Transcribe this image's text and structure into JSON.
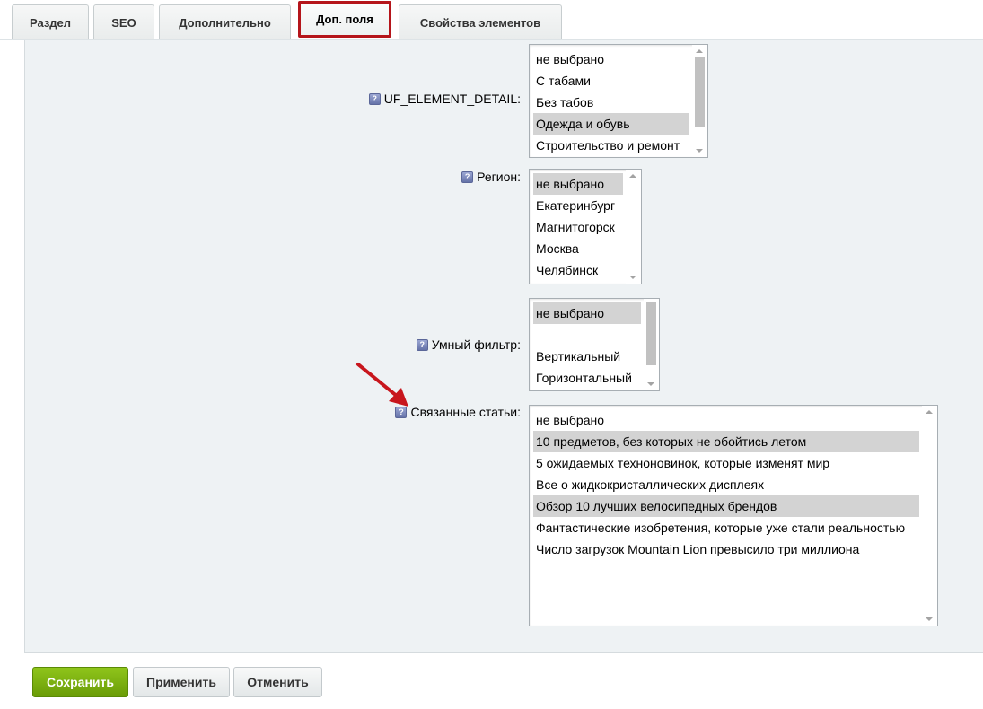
{
  "tabs": [
    {
      "label": "Раздел"
    },
    {
      "label": "SEO"
    },
    {
      "label": "Дополнительно"
    },
    {
      "label": "Доп. поля",
      "active": true
    },
    {
      "label": "Свойства элементов"
    }
  ],
  "fields": {
    "uf_element_detail": {
      "label": "UF_ELEMENT_DETAIL:",
      "options": [
        "не выбрано",
        "С табами",
        "Без табов",
        "Одежда и обувь",
        "Строительство и ремонт"
      ],
      "selected": [
        "Одежда и обувь"
      ]
    },
    "region": {
      "label": "Регион:",
      "options": [
        "не выбрано",
        "Екатеринбург",
        "Магнитогорск",
        "Москва",
        "Челябинск"
      ],
      "selected": [
        "не выбрано"
      ]
    },
    "smart_filter": {
      "label": "Умный фильтр:",
      "options": [
        "не выбрано",
        "",
        "Вертикальный",
        "Горизонтальный"
      ],
      "selected": [
        "не выбрано"
      ]
    },
    "related_articles": {
      "label": "Связанные статьи:",
      "options": [
        "не выбрано",
        "10 предметов, без которых не обойтись летом",
        "5 ожидаемых техноновинок, которые изменят мир",
        "Все о жидкокристаллических дисплеях",
        "Обзор 10 лучших велосипедных брендов",
        "Фантастические изобретения, которые уже стали реальностью",
        "Число загрузок Mountain Lion превысило три миллиона"
      ],
      "selected": [
        "10 предметов, без которых не обойтись летом",
        "Обзор 10 лучших велосипедных брендов"
      ]
    }
  },
  "buttons": {
    "save": "Сохранить",
    "apply": "Применить",
    "cancel": "Отменить"
  },
  "icons": {
    "hint": "help-hint-icon",
    "hint_glyph": "?",
    "annotation": "red-arrow-annotation"
  },
  "colors": {
    "active_tab_border": "#b5151b",
    "save_button": "#7bb012",
    "annotation_arrow": "#c8161d",
    "selected_option": "#d3d3d3"
  }
}
